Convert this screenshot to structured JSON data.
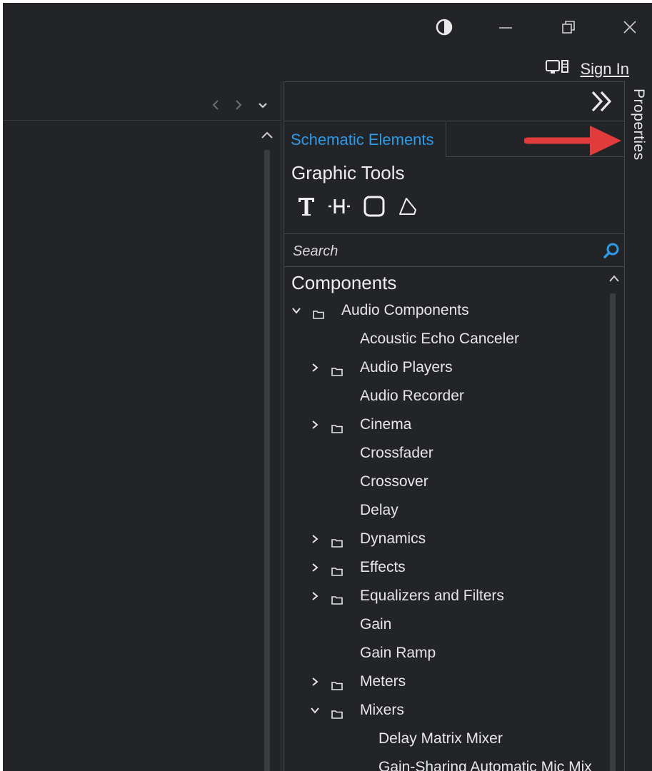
{
  "window": {
    "signin_label": "Sign In"
  },
  "panel": {
    "tab_label": "Schematic Elements",
    "graphic_tools_title": "Graphic Tools",
    "search_placeholder": "Search",
    "components_title": "Components",
    "properties_label": "Properties",
    "tree": [
      {
        "label": "Audio Components",
        "level": 0,
        "type": "folder",
        "expanded": true
      },
      {
        "label": "Acoustic Echo Canceler",
        "level": 1,
        "type": "item"
      },
      {
        "label": "Audio Players",
        "level": 1,
        "type": "folder",
        "expanded": false
      },
      {
        "label": "Audio Recorder",
        "level": 1,
        "type": "item"
      },
      {
        "label": "Cinema",
        "level": 1,
        "type": "folder",
        "expanded": false
      },
      {
        "label": "Crossfader",
        "level": 1,
        "type": "item"
      },
      {
        "label": "Crossover",
        "level": 1,
        "type": "item"
      },
      {
        "label": "Delay",
        "level": 1,
        "type": "item"
      },
      {
        "label": "Dynamics",
        "level": 1,
        "type": "folder",
        "expanded": false
      },
      {
        "label": "Effects",
        "level": 1,
        "type": "folder",
        "expanded": false
      },
      {
        "label": "Equalizers and Filters",
        "level": 1,
        "type": "folder",
        "expanded": false
      },
      {
        "label": "Gain",
        "level": 1,
        "type": "item"
      },
      {
        "label": "Gain Ramp",
        "level": 1,
        "type": "item"
      },
      {
        "label": "Meters",
        "level": 1,
        "type": "folder",
        "expanded": false
      },
      {
        "label": "Mixers",
        "level": 1,
        "type": "folder",
        "expanded": true
      },
      {
        "label": "Delay Matrix Mixer",
        "level": 2,
        "type": "item"
      },
      {
        "label": "Gain-Sharing Automatic Mic Mix",
        "level": 2,
        "type": "item"
      }
    ]
  },
  "colors": {
    "background": "#222428",
    "accent_tab": "#2d9be8",
    "search_icon": "#2d9be8",
    "annotation_arrow": "#e23b3b"
  }
}
